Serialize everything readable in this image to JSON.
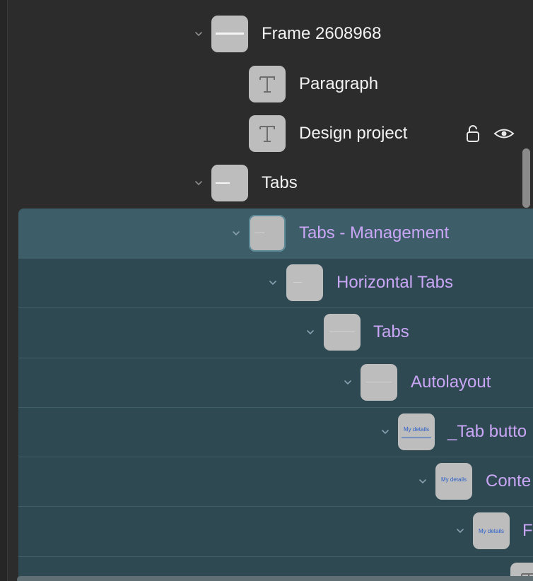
{
  "layers": [
    {
      "label": "Frame 2608968",
      "thumb": "frame",
      "expanded": true,
      "selected": false
    },
    {
      "label": "Paragraph",
      "thumb": "text",
      "expanded": false,
      "selected": false
    },
    {
      "label": "Design project",
      "thumb": "text",
      "expanded": false,
      "selected": false,
      "hover_actions": [
        "unlock-icon",
        "eye-icon"
      ]
    },
    {
      "label": "Tabs",
      "thumb": "frame",
      "expanded": true,
      "selected": false
    },
    {
      "label": "Tabs - Management",
      "thumb": "frame",
      "expanded": true,
      "selected": true
    },
    {
      "label": "Horizontal Tabs",
      "thumb": "frame",
      "expanded": true,
      "selected": true
    },
    {
      "label": "Tabs",
      "thumb": "frame",
      "expanded": true,
      "selected": true
    },
    {
      "label": "Autolayout",
      "thumb": "frame",
      "expanded": true,
      "selected": true
    },
    {
      "label": "_Tab butto",
      "thumb": "tab",
      "thumb_text": "My details",
      "expanded": true,
      "selected": true
    },
    {
      "label": "Conte",
      "thumb": "tab",
      "thumb_text": "My details",
      "expanded": true,
      "selected": true
    },
    {
      "label": "F",
      "thumb": "tab",
      "thumb_text": "My details",
      "expanded": true,
      "selected": true
    }
  ],
  "colors": {
    "panel_bg": "#2c2c2c",
    "selection_bg": "#2f4953",
    "selection_primary_bg": "#3d5e69",
    "selected_text": "#c9a6f5",
    "default_text": "#f2f2f2"
  }
}
